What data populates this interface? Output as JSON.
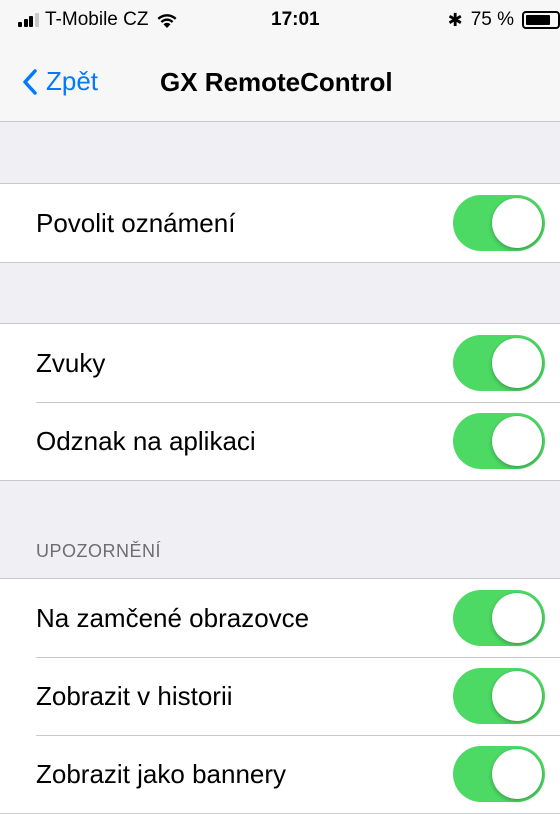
{
  "status_bar": {
    "carrier": "T-Mobile CZ",
    "time": "17:01",
    "battery_percent": "75 %",
    "battery_level": 0.75,
    "icons": [
      "signal-icon",
      "wifi-icon",
      "bluetooth-icon",
      "battery-icon"
    ]
  },
  "nav": {
    "back_label": "Zpět",
    "title": "GX RemoteControl"
  },
  "colors": {
    "accent": "#007aff",
    "toggle_on": "#4cd964",
    "background": "#efeff4"
  },
  "groups": [
    {
      "rows": [
        {
          "label": "Povolit oznámení",
          "on": true
        }
      ]
    },
    {
      "rows": [
        {
          "label": "Zvuky",
          "on": true
        },
        {
          "label": "Odznak na aplikaci",
          "on": true
        }
      ]
    },
    {
      "header": "UPOZORNĚNÍ",
      "rows": [
        {
          "label": "Na zamčené obrazovce",
          "on": true
        },
        {
          "label": "Zobrazit v historii",
          "on": true
        },
        {
          "label": "Zobrazit jako bannery",
          "on": true
        }
      ]
    }
  ]
}
